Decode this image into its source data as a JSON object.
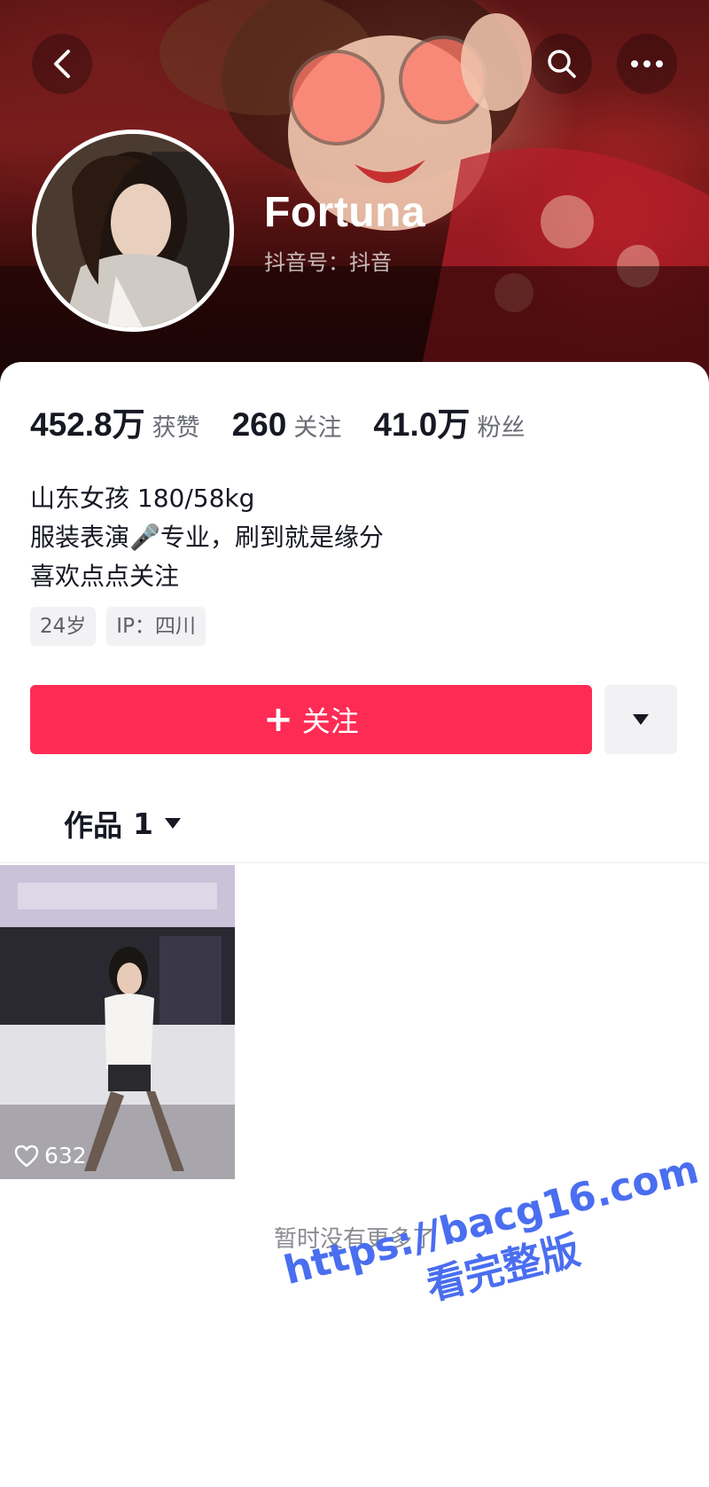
{
  "header": {
    "display_name": "Fortuna",
    "handle": "抖音号：抖音"
  },
  "stats": [
    {
      "value": "452.8万",
      "label": "获赞"
    },
    {
      "value": "260",
      "label": "关注"
    },
    {
      "value": "41.0万",
      "label": "粉丝"
    }
  ],
  "bio": [
    "山东女孩 180/58kg",
    "服装表演🎤专业，刷到就是缘分",
    "喜欢点点关注"
  ],
  "tags": [
    "24岁",
    "IP：四川"
  ],
  "actions": {
    "follow_plus": "+",
    "follow_label": "关注"
  },
  "works": {
    "label": "作品",
    "count": "1"
  },
  "video": {
    "likes": "632"
  },
  "footer": {
    "no_more": "暂时没有更多了"
  },
  "watermark": {
    "url": "https://bacg16.com",
    "subtitle": "看完整版"
  },
  "colors": {
    "accent": "#fe2c55",
    "banner": "#5a1414",
    "watermark": "#4a6ef0"
  },
  "icons": [
    "back-icon",
    "search-icon",
    "more-icon",
    "caret-down-icon",
    "heart-icon"
  ]
}
